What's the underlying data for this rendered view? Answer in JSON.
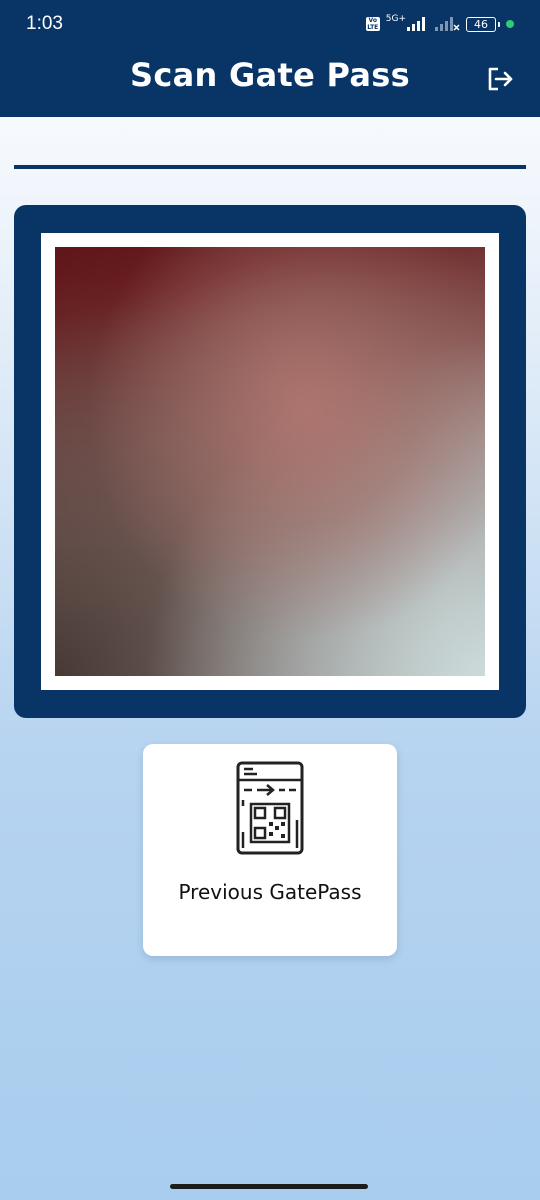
{
  "status_bar": {
    "time": "1:03",
    "network_label": "5G+",
    "volte_label": "Vo LTE",
    "battery_level": "46"
  },
  "header": {
    "title": "Scan Gate Pass",
    "logout_icon": "logout-icon",
    "background_color": "#083466"
  },
  "scanner": {
    "frame_color": "#083466",
    "camera_state": "live-preview-blurred"
  },
  "previous_gatepass": {
    "label": "Previous GatePass",
    "icon": "qr-gatepass-icon"
  },
  "colors": {
    "primary": "#083466",
    "card": "#ffffff",
    "status_dot": "#2ecc71"
  }
}
